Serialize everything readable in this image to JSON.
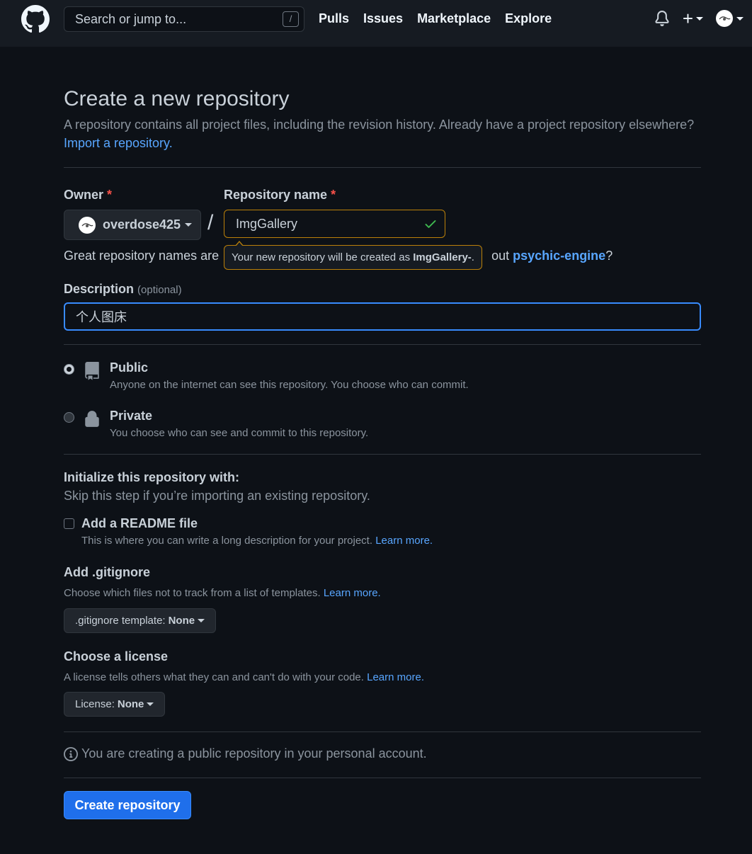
{
  "header": {
    "search_placeholder": "Search or jump to...",
    "search_shortcut": "/",
    "nav": [
      "Pulls",
      "Issues",
      "Marketplace",
      "Explore"
    ],
    "plus_label": "+"
  },
  "page": {
    "title": "Create a new repository",
    "subtitle": "A repository contains all project files, including the revision history. Already have a project repository elsewhere?",
    "import_link": "Import a repository."
  },
  "form": {
    "owner_label": "Owner",
    "required_mark": "*",
    "owner_value": "overdose425",
    "slash": "/",
    "repo_label": "Repository name",
    "repo_value": "ImgGallery",
    "hint_prefix": "Great repository names are sh",
    "hint_suffix": "out",
    "hint_suggestion": "psychic-engine",
    "hint_end": "?",
    "tooltip_prefix": "Your new repository will be created as",
    "tooltip_name": "ImgGallery-",
    "tooltip_end": ".",
    "desc_label": "Description",
    "desc_optional": "(optional)",
    "desc_value": "个人图床"
  },
  "visibility": {
    "public_title": "Public",
    "public_desc": "Anyone on the internet can see this repository. You choose who can commit.",
    "private_title": "Private",
    "private_desc": "You choose who can see and commit to this repository.",
    "selected": "public"
  },
  "init": {
    "title": "Initialize this repository with:",
    "note": "Skip this step if you’re importing an existing repository.",
    "readme_title": "Add a README file",
    "readme_desc": "This is where you can write a long description for your project.",
    "readme_link": "Learn more.",
    "readme_checked": false
  },
  "gitignore": {
    "title": "Add .gitignore",
    "desc": "Choose which files not to track from a list of templates.",
    "link": "Learn more.",
    "select_label": ".gitignore template:",
    "select_value": "None"
  },
  "license": {
    "title": "Choose a license",
    "desc": "A license tells others what they can and can't do with your code.",
    "link": "Learn more.",
    "select_label": "License:",
    "select_value": "None"
  },
  "footer": {
    "info": "You are creating a public repository in your personal account.",
    "create_button": "Create repository"
  },
  "colors": {
    "background": "#0d1117",
    "header": "#161b22",
    "link": "#58a6ff",
    "primary_button": "#1f6feb",
    "success": "#3fb950",
    "warning_border": "#bb8009"
  }
}
